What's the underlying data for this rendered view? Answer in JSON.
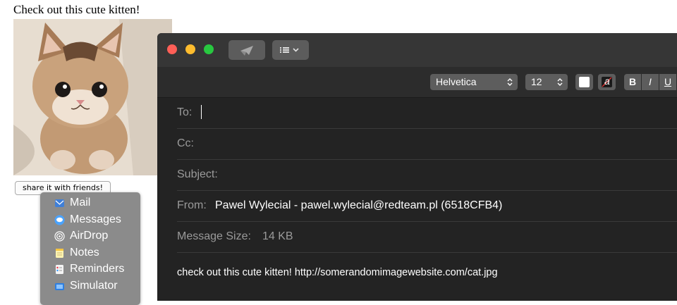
{
  "page": {
    "heading": "Check out this cute kitten!",
    "share_button_label": "share it with friends!"
  },
  "share_menu": {
    "items": [
      {
        "label": "Mail",
        "icon": "mail-icon"
      },
      {
        "label": "Messages",
        "icon": "messages-icon"
      },
      {
        "label": "AirDrop",
        "icon": "airdrop-icon"
      },
      {
        "label": "Notes",
        "icon": "notes-icon"
      },
      {
        "label": "Reminders",
        "icon": "reminders-icon"
      },
      {
        "label": "Simulator",
        "icon": "simulator-icon"
      }
    ]
  },
  "mail": {
    "toolbar": {
      "font": "Helvetica",
      "font_size": "12",
      "bold": "B",
      "italic": "I",
      "underline": "U",
      "text_color_glyph": "a"
    },
    "fields": {
      "to_label": "To:",
      "to_value": "",
      "cc_label": "Cc:",
      "subject_label": "Subject:",
      "from_label": "From:",
      "from_value": "Pawel Wylecial - pawel.wylecial@redteam.pl (6518CFB4)",
      "size_label": "Message Size:",
      "size_value": "14 KB"
    },
    "body": "check out this cute kitten! http://somerandomimagewebsite.com/cat.jpg"
  },
  "colors": {
    "close": "#ff5f57",
    "minimize": "#febc2e",
    "zoom": "#28c840",
    "window_bg": "#232323",
    "menu_bg": "#8b8b8b"
  }
}
